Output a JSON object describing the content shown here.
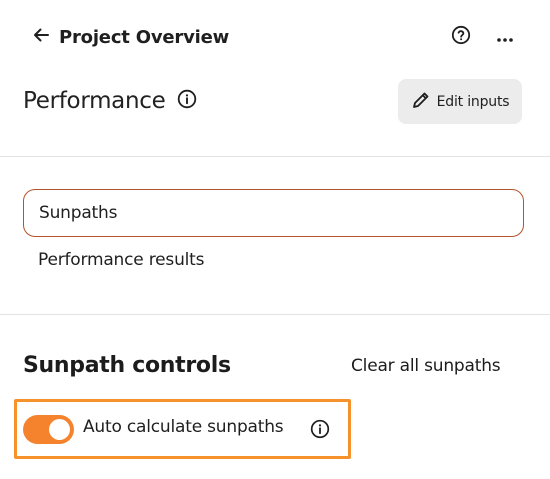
{
  "header": {
    "back_label": "Project Overview",
    "icons": {
      "back": "arrow-left-icon",
      "help": "help-circle-icon",
      "more": "more-horizontal-icon"
    }
  },
  "title": {
    "text": "Performance",
    "info_icon": "info-icon"
  },
  "edit_button": {
    "label": "Edit inputs",
    "icon": "pencil-icon"
  },
  "tabs": [
    {
      "label": "Sunpaths",
      "active": true
    },
    {
      "label": "Performance results",
      "active": false
    }
  ],
  "sunpath_controls": {
    "title": "Sunpath controls",
    "clear_label": "Clear all sunpaths",
    "auto_calc": {
      "label": "Auto calculate sunpaths",
      "enabled": true,
      "info_icon": "info-icon"
    }
  },
  "colors": {
    "accent_orange": "#f5832d",
    "highlight_border": "#f5922b",
    "active_tab_border": "#b3532a",
    "button_bg": "#ececec"
  }
}
